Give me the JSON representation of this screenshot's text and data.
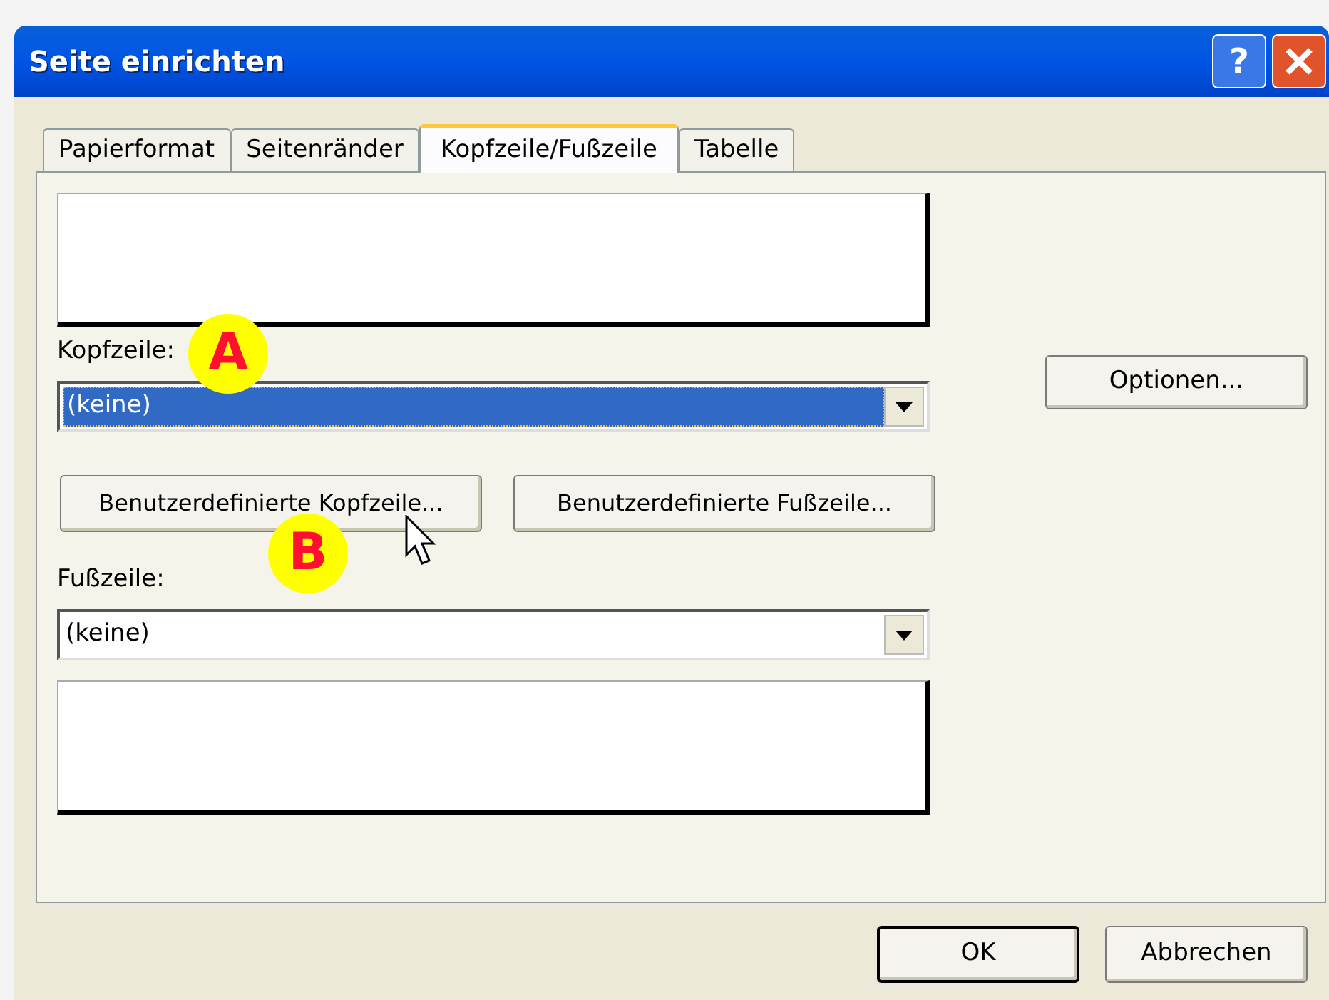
{
  "window": {
    "title": "Seite einrichten",
    "help_button": "?"
  },
  "tabs": [
    {
      "label": "Papierformat",
      "selected": false
    },
    {
      "label": "Seitenränder",
      "selected": false
    },
    {
      "label": "Kopfzeile/Fußzeile",
      "selected": true
    },
    {
      "label": "Tabelle",
      "selected": false
    }
  ],
  "header": {
    "label": "Kopfzeile:",
    "value": "(keine)",
    "focused": true
  },
  "custom_buttons": [
    {
      "label": "Benutzerdefinierte Kopfzeile..."
    },
    {
      "label": "Benutzerdefinierte Fußzeile..."
    }
  ],
  "footer": {
    "label": "Fußzeile:",
    "value": "(keine)",
    "focused": false
  },
  "options_button": "Optionen...",
  "buttons": [
    {
      "label": "OK",
      "default": true
    },
    {
      "label": "Abbrechen",
      "default": false
    }
  ],
  "callouts": [
    {
      "label": "A"
    },
    {
      "label": "B"
    }
  ]
}
